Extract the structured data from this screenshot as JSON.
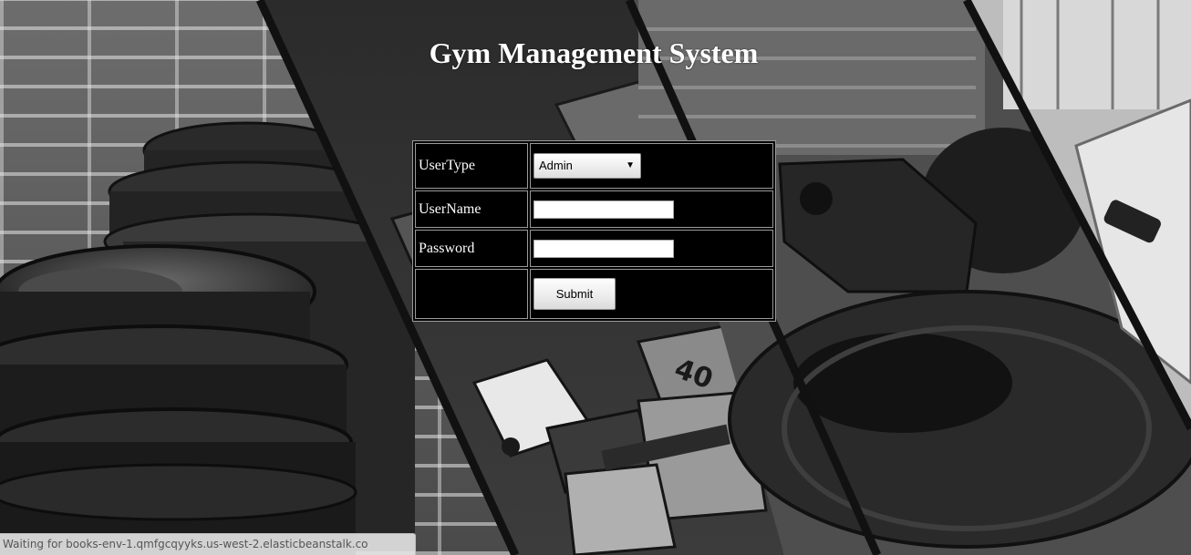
{
  "page": {
    "title": "Gym Management System"
  },
  "login_form": {
    "usertype_label": "UserType",
    "usertype_selected": "Admin",
    "username_label": "UserName",
    "username_value": "",
    "password_label": "Password",
    "password_value": "",
    "submit_label": "Submit"
  },
  "status_bar": {
    "text": "Waiting for books-env-1.qmfgcqyyks.us-west-2.elasticbeanstalk.co"
  },
  "icons": {
    "select_arrow": "dropdown-arrow-icon"
  },
  "colors": {
    "form_background": "#000000",
    "form_border": "#9a9a9a",
    "title_text": "#ffffff"
  }
}
